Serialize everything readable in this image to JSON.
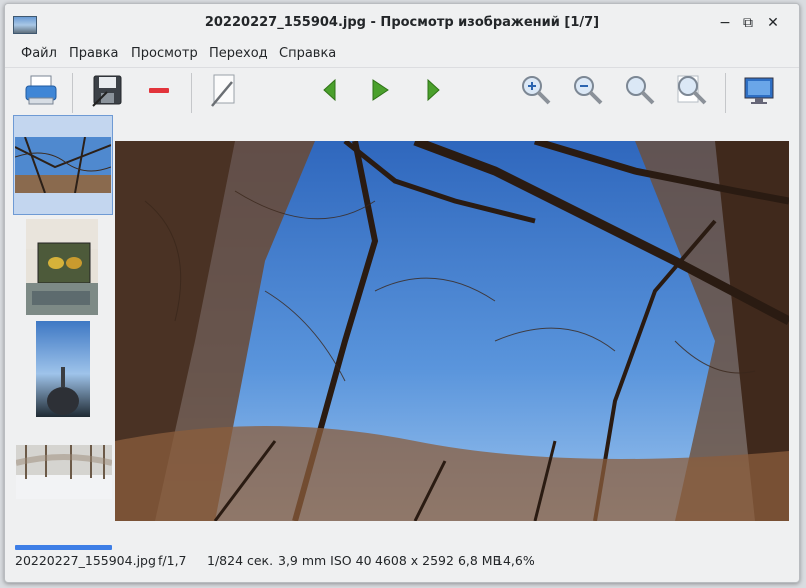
{
  "window": {
    "title": "20220227_155904.jpg - Просмотр изображений [1/7]"
  },
  "title_buttons": {
    "minimize": "−",
    "maximize": "⧉",
    "close": "✕"
  },
  "menu": [
    "Файл",
    "Правка",
    "Просмотр",
    "Переход",
    "Справка"
  ],
  "toolbar": {
    "icons": [
      "print-icon",
      "save-icon",
      "delete-icon",
      "edit-icon",
      "previous-icon",
      "slideshow-icon",
      "next-icon",
      "zoom-in-icon",
      "zoom-out-icon",
      "zoom-fit-icon",
      "zoom-original-icon",
      "fullscreen-icon"
    ]
  },
  "thumbnails": [
    "sky-trees",
    "painting-table",
    "sea-rocks",
    "snowy-park"
  ],
  "status": {
    "filename": "20220227_155904.jpg",
    "aperture": "f/1,7",
    "shutter": "1/824 сек.",
    "focal_iso": "3,9 mm ISO 40",
    "dimensions_size": "4608 x 2592 6,8 МБ",
    "zoom": "14,6%",
    "progress": 1.0
  },
  "colors": {
    "accent": "#3d7ee6",
    "sky": "#5a86c8",
    "window_bg": "#eff0f1"
  }
}
